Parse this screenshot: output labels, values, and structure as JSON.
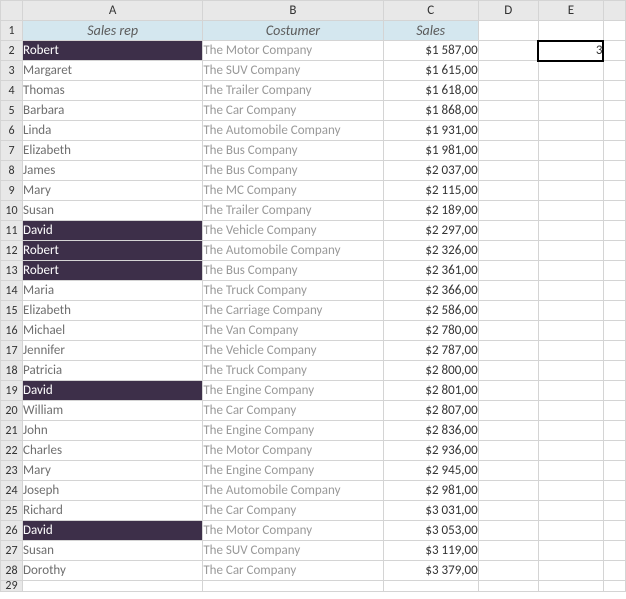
{
  "columns": [
    "A",
    "B",
    "C",
    "D",
    "E"
  ],
  "headers": {
    "A": "Sales rep",
    "B": "Costumer",
    "C": "Sales"
  },
  "selected_cell": {
    "addr": "E2",
    "value": "3"
  },
  "rows": [
    {
      "n": 2,
      "a": "Robert",
      "b": "The Motor Company",
      "c": "$1 587,00",
      "hl": true
    },
    {
      "n": 3,
      "a": "Margaret",
      "b": "The SUV Company",
      "c": "$1 615,00",
      "hl": false
    },
    {
      "n": 4,
      "a": "Thomas",
      "b": "The Trailer Company",
      "c": "$1 618,00",
      "hl": false
    },
    {
      "n": 5,
      "a": "Barbara",
      "b": "The Car Company",
      "c": "$1 868,00",
      "hl": false
    },
    {
      "n": 6,
      "a": "Linda",
      "b": "The Automobile Company",
      "c": "$1 931,00",
      "hl": false
    },
    {
      "n": 7,
      "a": "Elizabeth",
      "b": "The Bus Company",
      "c": "$1 981,00",
      "hl": false
    },
    {
      "n": 8,
      "a": "James",
      "b": "The Bus Company",
      "c": "$2 037,00",
      "hl": false
    },
    {
      "n": 9,
      "a": "Mary",
      "b": "The MC Company",
      "c": "$2 115,00",
      "hl": false
    },
    {
      "n": 10,
      "a": "Susan",
      "b": "The Trailer Company",
      "c": "$2 189,00",
      "hl": false
    },
    {
      "n": 11,
      "a": "David",
      "b": "The Vehicle Company",
      "c": "$2 297,00",
      "hl": true
    },
    {
      "n": 12,
      "a": "Robert",
      "b": "The Automobile Company",
      "c": "$2 326,00",
      "hl": true
    },
    {
      "n": 13,
      "a": "Robert",
      "b": "The Bus Company",
      "c": "$2 361,00",
      "hl": true
    },
    {
      "n": 14,
      "a": "Maria",
      "b": "The Truck Company",
      "c": "$2 366,00",
      "hl": false
    },
    {
      "n": 15,
      "a": "Elizabeth",
      "b": "The Carriage Company",
      "c": "$2 586,00",
      "hl": false
    },
    {
      "n": 16,
      "a": "Michael",
      "b": "The Van Company",
      "c": "$2 780,00",
      "hl": false
    },
    {
      "n": 17,
      "a": "Jennifer",
      "b": "The Vehicle Company",
      "c": "$2 787,00",
      "hl": false
    },
    {
      "n": 18,
      "a": "Patricia",
      "b": "The Truck Company",
      "c": "$2 800,00",
      "hl": false
    },
    {
      "n": 19,
      "a": "David",
      "b": "The Engine Company",
      "c": "$2 801,00",
      "hl": true
    },
    {
      "n": 20,
      "a": "William",
      "b": "The Car Company",
      "c": "$2 807,00",
      "hl": false
    },
    {
      "n": 21,
      "a": "John",
      "b": "The Engine Company",
      "c": "$2 836,00",
      "hl": false
    },
    {
      "n": 22,
      "a": "Charles",
      "b": "The Motor Company",
      "c": "$2 936,00",
      "hl": false
    },
    {
      "n": 23,
      "a": "Mary",
      "b": "The Engine Company",
      "c": "$2 945,00",
      "hl": false
    },
    {
      "n": 24,
      "a": "Joseph",
      "b": "The Automobile Company",
      "c": "$2 981,00",
      "hl": false
    },
    {
      "n": 25,
      "a": "Richard",
      "b": "The Car Company",
      "c": "$3 031,00",
      "hl": false
    },
    {
      "n": 26,
      "a": "David",
      "b": "The Motor Company",
      "c": "$3 053,00",
      "hl": true
    },
    {
      "n": 27,
      "a": "Susan",
      "b": "The SUV Company",
      "c": "$3 119,00",
      "hl": false
    },
    {
      "n": 28,
      "a": "Dorothy",
      "b": "The Car Company",
      "c": "$3 379,00",
      "hl": false
    }
  ],
  "extra_row": 29,
  "chart_data": {
    "type": "table",
    "title": "",
    "columns": [
      "Sales rep",
      "Costumer",
      "Sales"
    ],
    "rows": [
      [
        "Robert",
        "The Motor Company",
        1587.0
      ],
      [
        "Margaret",
        "The SUV Company",
        1615.0
      ],
      [
        "Thomas",
        "The Trailer Company",
        1618.0
      ],
      [
        "Barbara",
        "The Car Company",
        1868.0
      ],
      [
        "Linda",
        "The Automobile Company",
        1931.0
      ],
      [
        "Elizabeth",
        "The Bus Company",
        1981.0
      ],
      [
        "James",
        "The Bus Company",
        2037.0
      ],
      [
        "Mary",
        "The MC Company",
        2115.0
      ],
      [
        "Susan",
        "The Trailer Company",
        2189.0
      ],
      [
        "David",
        "The Vehicle Company",
        2297.0
      ],
      [
        "Robert",
        "The Automobile Company",
        2326.0
      ],
      [
        "Robert",
        "The Bus Company",
        2361.0
      ],
      [
        "Maria",
        "The Truck Company",
        2366.0
      ],
      [
        "Elizabeth",
        "The Carriage Company",
        2586.0
      ],
      [
        "Michael",
        "The Van Company",
        2780.0
      ],
      [
        "Jennifer",
        "The Vehicle Company",
        2787.0
      ],
      [
        "Patricia",
        "The Truck Company",
        2800.0
      ],
      [
        "David",
        "The Engine Company",
        2801.0
      ],
      [
        "William",
        "The Car Company",
        2807.0
      ],
      [
        "John",
        "The Engine Company",
        2836.0
      ],
      [
        "Charles",
        "The Motor Company",
        2936.0
      ],
      [
        "Mary",
        "The Engine Company",
        2945.0
      ],
      [
        "Joseph",
        "The Automobile Company",
        2981.0
      ],
      [
        "Richard",
        "The Car Company",
        3031.0
      ],
      [
        "David",
        "The Motor Company",
        3053.0
      ],
      [
        "Susan",
        "The SUV Company",
        3119.0
      ],
      [
        "Dorothy",
        "The Car Company",
        3379.0
      ]
    ]
  }
}
